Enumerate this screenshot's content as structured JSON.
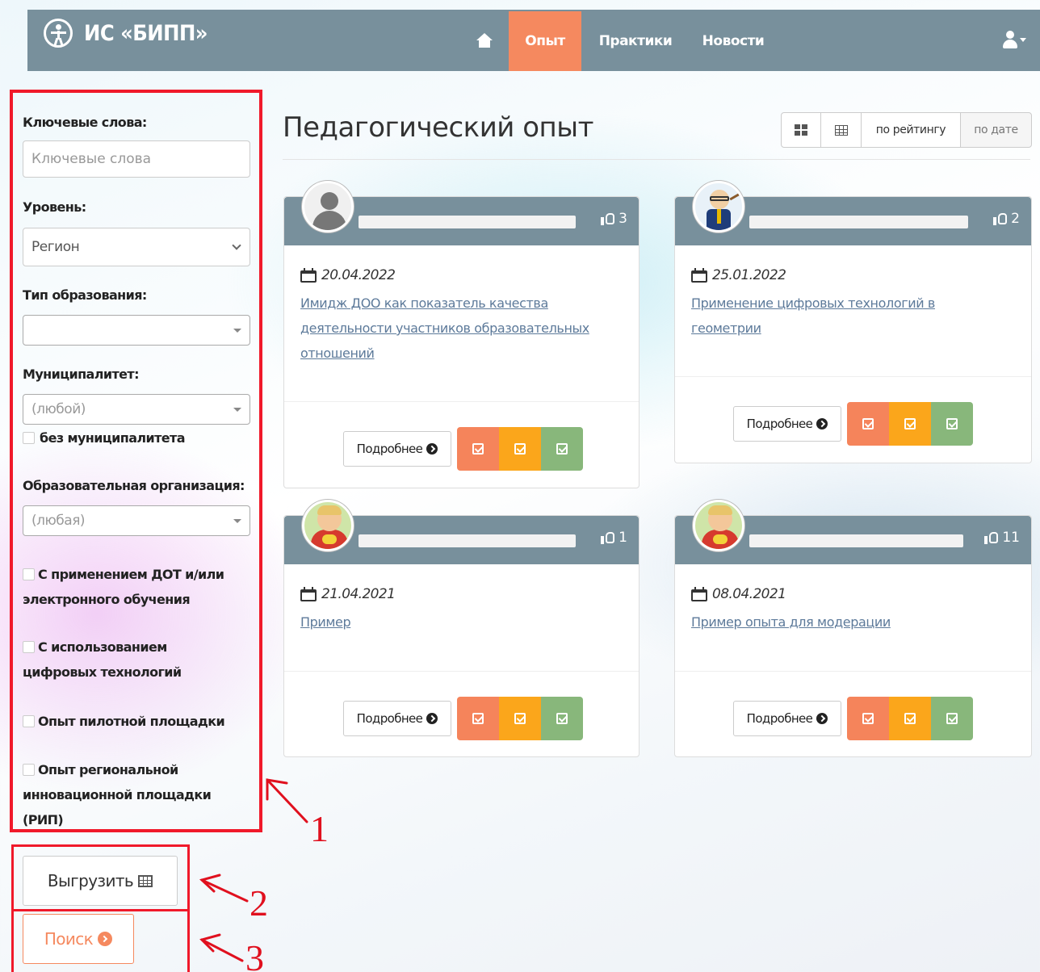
{
  "navbar": {
    "brand": "ИС «БИПП»",
    "brand_icon": "accessibility-icon",
    "home_icon": "home-icon",
    "items": [
      {
        "label": "Опыт",
        "active": true
      },
      {
        "label": "Практики",
        "active": false
      },
      {
        "label": "Новости",
        "active": false
      }
    ],
    "user_icon": "user-icon",
    "active_color": "#f5895f",
    "bar_color": "#78909c"
  },
  "filters": {
    "keywords_label": "Ключевые слова:",
    "keywords_placeholder": "Ключевые слова",
    "level_label": "Уровень:",
    "level_value": "Регион",
    "edu_type_label": "Тип образования:",
    "edu_type_value": "",
    "municipality_label": "Муниципалитет:",
    "municipality_value": "(любой)",
    "no_municipality_label": "без муниципалитета",
    "org_label": "Образовательная организация:",
    "org_value": "(любая)",
    "checkbox_dot_label": "С применением ДОТ и/или электронного обучения",
    "checkbox_digital_label": "С использованием цифровых технологий",
    "checkbox_pilot_label": "Опыт пилотной площадки",
    "checkbox_rip_label": "Опыт региональной инновационной площадки (РИП)"
  },
  "actions": {
    "export_label": "Выгрузить",
    "search_label": "Поиск"
  },
  "main": {
    "title": "Педагогический опыт",
    "sort_rating": "по рейтингу",
    "sort_date": "по дате",
    "more_label": "Подробнее",
    "cards": [
      {
        "likes": "3",
        "date": "20.04.2022",
        "title": "Имидж ДОО как показатель качества деятельности участников образовательных отношений",
        "avatar": "default-user-avatar"
      },
      {
        "likes": "2",
        "date": "25.01.2022",
        "title": "Применение цифровых технологий в геометрии",
        "avatar": "teacher-avatar"
      },
      {
        "likes": "1",
        "date": "21.04.2021",
        "title": "Пример",
        "avatar": "child-avatar"
      },
      {
        "likes": "11",
        "date": "08.04.2021",
        "title": "Пример опыта для модерации",
        "avatar": "child-avatar"
      }
    ],
    "mark_colors": [
      "#f5845b",
      "#fba61b",
      "#88b77b"
    ]
  },
  "annotations": [
    "1",
    "2",
    "3"
  ]
}
